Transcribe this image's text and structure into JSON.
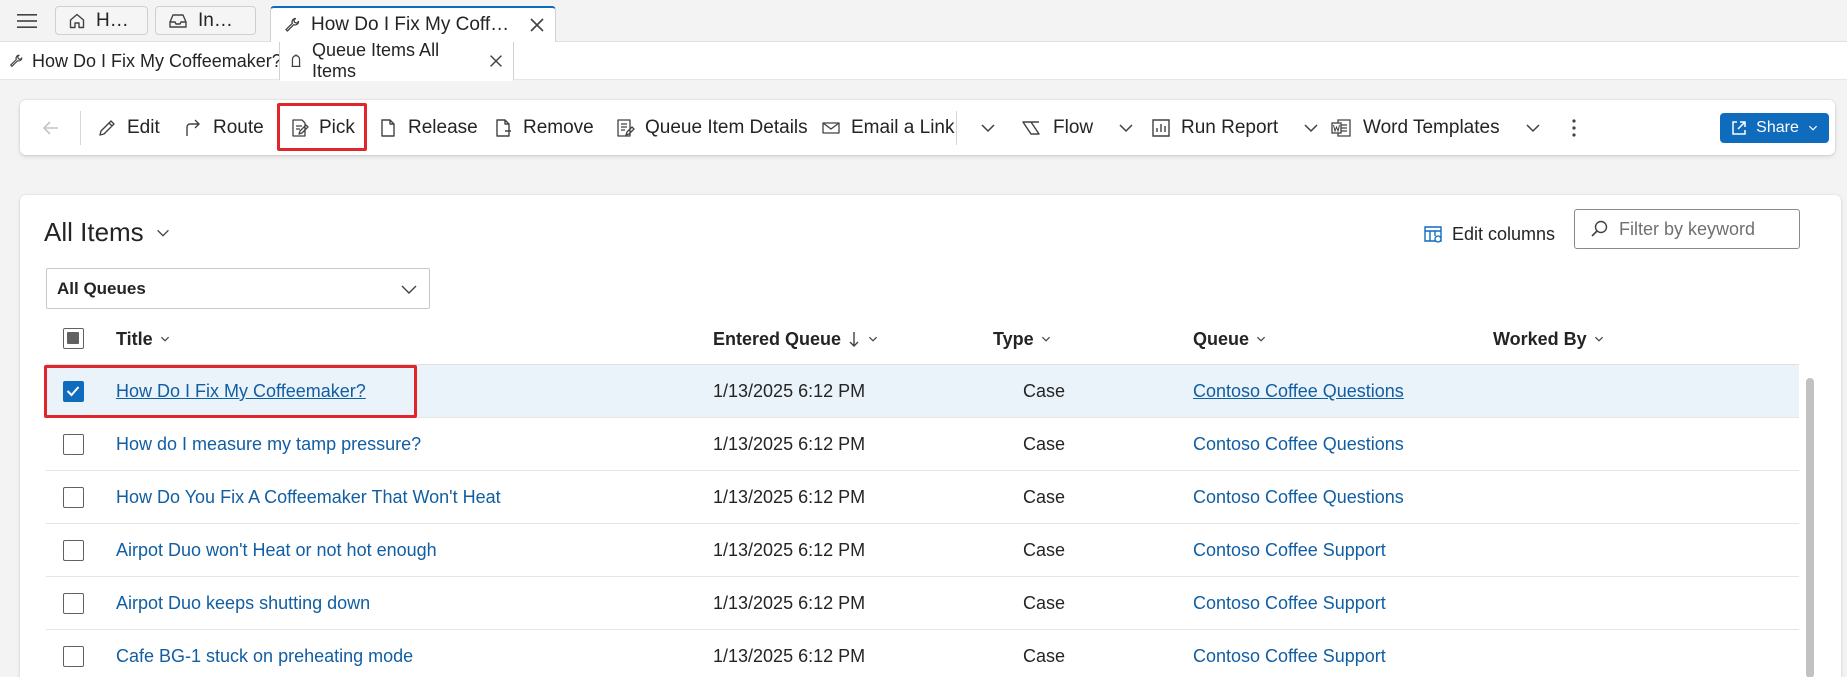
{
  "session_tabs": [
    {
      "label": "Home",
      "icon": "home-icon"
    },
    {
      "label": "Inbox",
      "icon": "inbox-icon"
    },
    {
      "label": "How Do I Fix My Coffeema...",
      "icon": "wrench-icon",
      "active": true
    }
  ],
  "sub_tabs": [
    {
      "label": "How Do I Fix My Coffeemaker?",
      "icon": "wrench-icon"
    },
    {
      "label": "Queue Items All Items",
      "icon": "queue-icon",
      "active": true
    }
  ],
  "command_bar": {
    "edit": "Edit",
    "route": "Route",
    "pick": "Pick",
    "release": "Release",
    "remove": "Remove",
    "queue_item_details": "Queue Item Details",
    "email_a_link": "Email a Link",
    "flow": "Flow",
    "run_report": "Run Report",
    "word_templates": "Word Templates",
    "share": "Share"
  },
  "view": {
    "title": "All Items",
    "edit_columns": "Edit columns",
    "filter_placeholder": "Filter by keyword",
    "queue_filter": "All Queues"
  },
  "grid": {
    "columns": [
      "Title",
      "Entered Queue",
      "Type",
      "Queue",
      "Worked By"
    ],
    "rows": [
      {
        "title": "How Do I Fix My Coffeemaker?",
        "entered": "1/13/2025 6:12 PM",
        "type": "Case",
        "queue": "Contoso Coffee Questions",
        "worked_by": "",
        "checked": true
      },
      {
        "title": "How do I measure my tamp pressure?",
        "entered": "1/13/2025 6:12 PM",
        "type": "Case",
        "queue": "Contoso Coffee Questions",
        "worked_by": "",
        "checked": false
      },
      {
        "title": "How Do You Fix A Coffeemaker That Won't Heat",
        "entered": "1/13/2025 6:12 PM",
        "type": "Case",
        "queue": "Contoso Coffee Questions",
        "worked_by": "",
        "checked": false
      },
      {
        "title": "Airpot Duo won't Heat or not hot enough",
        "entered": "1/13/2025 6:12 PM",
        "type": "Case",
        "queue": "Contoso Coffee Support",
        "worked_by": "",
        "checked": false
      },
      {
        "title": "Airpot Duo keeps shutting down",
        "entered": "1/13/2025 6:12 PM",
        "type": "Case",
        "queue": "Contoso Coffee Support",
        "worked_by": "",
        "checked": false
      },
      {
        "title": "Cafe BG-1 stuck on preheating mode",
        "entered": "1/13/2025 6:12 PM",
        "type": "Case",
        "queue": "Contoso Coffee Support",
        "worked_by": "",
        "checked": false
      }
    ]
  },
  "colors": {
    "accent": "#0f6cbd",
    "link": "#115ea3",
    "highlight": "#e0252c",
    "selected_row": "#eaf2fa"
  }
}
